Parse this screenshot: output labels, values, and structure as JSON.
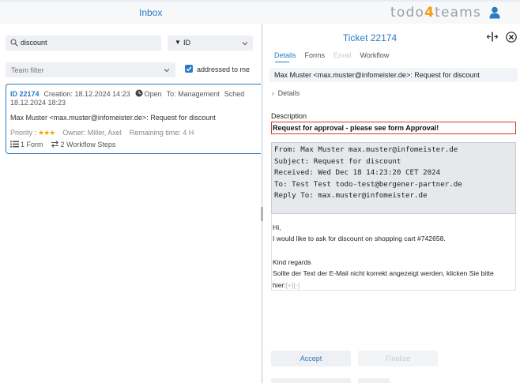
{
  "header": {
    "title": "Inbox",
    "logo_prefix": "todo",
    "logo_digit": "4",
    "logo_suffix": "teams"
  },
  "filters": {
    "search_value": "discount",
    "sort_value": "ID",
    "team_filter_placeholder": "Team filter",
    "addressed_to_me_label": "addressed to me",
    "addressed_to_me_checked": true
  },
  "ticket_card": {
    "id": "ID 22174",
    "creation": "Creation: 18.12.2024 14:23",
    "status": "Open",
    "to": "To: Management",
    "scheduled_label": "Sched",
    "scheduled_date": "18.12.2024 18:23",
    "subject": "Max Muster <max.muster@infomeister.de>: Request for discount",
    "priority_label": "Priority :",
    "priority_stars": "★★★",
    "owner": "Owner: Miller, Axel",
    "remaining": "Remaining time: 4 H",
    "forms": "1 Form",
    "workflow_steps": "2 Workflow Steps"
  },
  "detail": {
    "title": "Ticket 22174",
    "tabs": [
      {
        "label": "Details",
        "state": "active"
      },
      {
        "label": "Forms",
        "state": "normal"
      },
      {
        "label": "Email",
        "state": "disabled"
      },
      {
        "label": "Workflow",
        "state": "normal"
      }
    ],
    "from_subject": "Max Muster <max.muster@infomeister.de>: Request for discount",
    "details_label": "Details",
    "description_label": "Description",
    "description_value": "Request for approval - please see form Approval!",
    "email_header": [
      "From: Max Muster  max.muster@infomeister.de",
      "Subject: Request for discount",
      "Received: Wed Dec 18 14:23:20 CET 2024",
      "To: Test Test  todo-test@bergener-partner.de",
      "Reply To: max.muster@infomeister.de"
    ],
    "email_body": {
      "greeting": "Hi,",
      "line1": "I would like to ask for discount on shopping cart #742658.",
      "closing": "Kind regards",
      "notice": "Sollte der Text der E-Mail nicht korrekt angezeigt werden, klicken Sie bitte",
      "notice2": "hier:",
      "link": "[+][-]"
    },
    "accept_label": "Accept",
    "finalize_label": "Finalize"
  },
  "colors": {
    "accent": "#2a7ac4",
    "logo_digit": "#f39c12",
    "stars": "#f0a800",
    "required_border": "#dd3333"
  },
  "icons": [
    "user-icon",
    "search-icon",
    "chevron-down-icon",
    "checkbox-checked-icon",
    "clock-icon",
    "list-icon",
    "workflow-icon",
    "split-view-icon",
    "close-icon",
    "chevron-right-icon"
  ]
}
